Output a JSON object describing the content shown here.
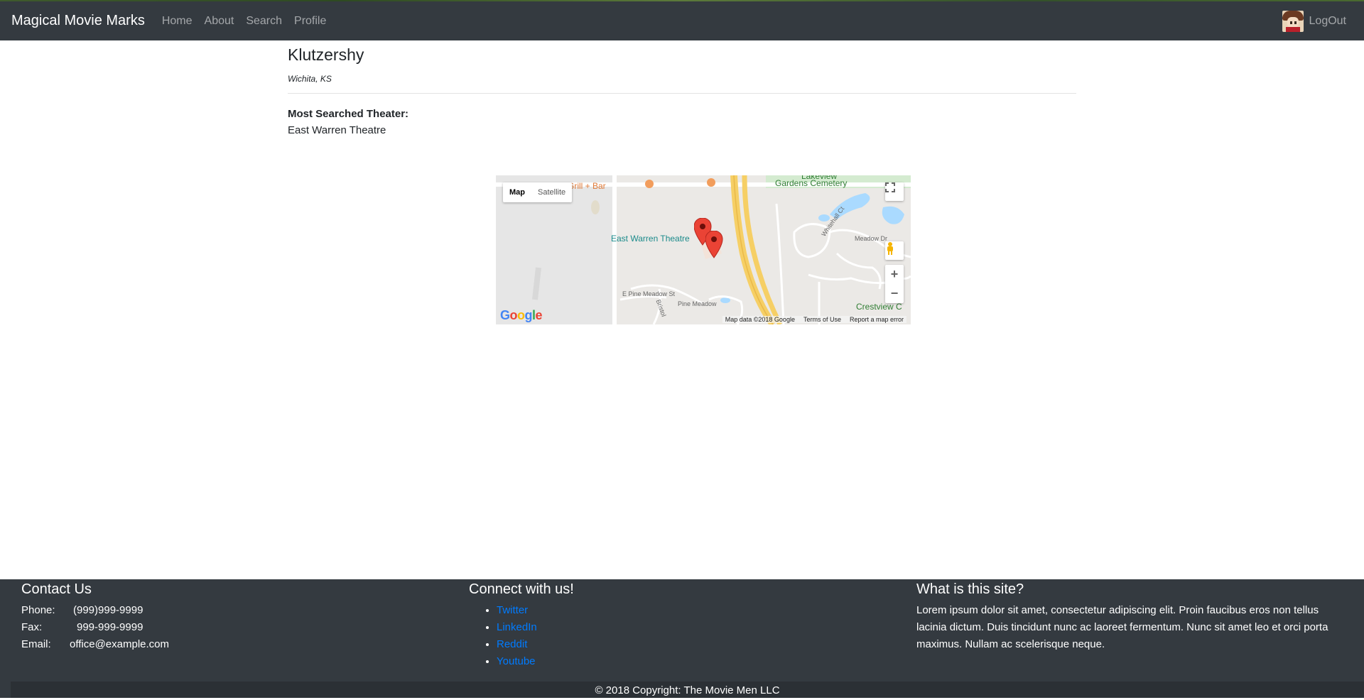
{
  "nav": {
    "brand": "Magical Movie Marks",
    "links": [
      "Home",
      "About",
      "Search",
      "Profile"
    ],
    "logout": "LogOut"
  },
  "profile": {
    "username": "Klutzershy",
    "location": "Wichita, KS",
    "most_searched_label": "Most Searched Theater:",
    "most_searched_value": "East Warren Theatre"
  },
  "map": {
    "type_map": "Map",
    "type_satellite": "Satellite",
    "labels": {
      "theatre": "East Warren Theatre",
      "restaurant": "lebee's Grill + Bar",
      "cemetery_top": "Lakeview",
      "cemetery": "Gardens Cemetery",
      "crestview": "Crestview C",
      "pine_meadow": "E Pine Meadow St",
      "pine_meadow2": "Pine Meadow",
      "meadow": "Meadow Dr",
      "whitehall": "Whitehall Ct",
      "bristol": "Bristol"
    },
    "google": "Google",
    "map_data": "Map data ©2018 Google",
    "terms": "Terms of Use",
    "report": "Report a map error",
    "zoom_in": "+",
    "zoom_out": "−"
  },
  "footer": {
    "contact": {
      "title": "Contact Us",
      "phone_label": "Phone:",
      "phone": "(999)999-9999",
      "fax_label": "Fax:",
      "fax": "999-999-9999",
      "email_label": "Email:",
      "email": "office@example.com"
    },
    "connect": {
      "title": "Connect with us!",
      "links": [
        "Twitter",
        "LinkedIn",
        "Reddit",
        "Youtube"
      ]
    },
    "about": {
      "title": "What is this site?",
      "text": "Lorem ipsum dolor sit amet, consectetur adipiscing elit. Proin faucibus eros non tellus lacinia dictum. Duis tincidunt nunc ac laoreet fermentum. Nunc sit amet leo et orci porta maximus. Nullam ac scelerisque neque."
    },
    "copyright": "© 2018 Copyright: The Movie Men LLC"
  },
  "colors": {
    "navbar": "#343a40",
    "link": "#007bff",
    "marker": "#ea4335",
    "highway": "#f6cf65",
    "water": "#aadaff",
    "park": "#c5e8c5"
  }
}
